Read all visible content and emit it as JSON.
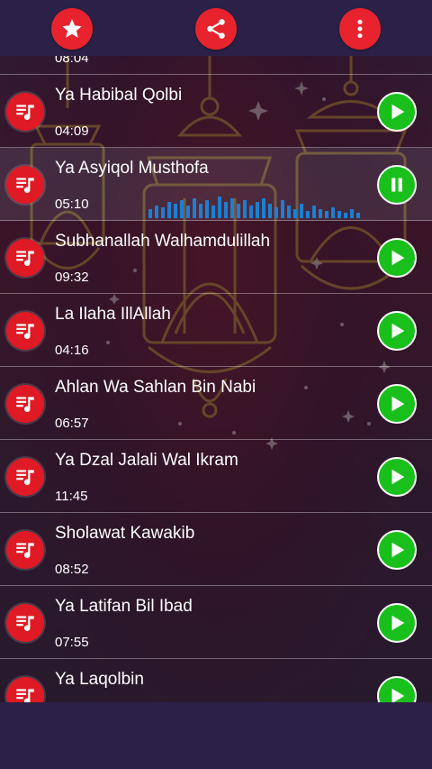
{
  "toolbar": {
    "favorite": "star-icon",
    "share": "share-icon",
    "more": "more-vertical-icon"
  },
  "colors": {
    "accent": "#e8232e",
    "play": "#19c01b",
    "bar_background": "#2b2146"
  },
  "playlist": {
    "partial_top_duration": "08:04",
    "now_playing_index": 1,
    "items": [
      {
        "title": "Ya Habibal Qolbi",
        "duration": "04:09",
        "state": "play"
      },
      {
        "title": "Ya Asyiqol Musthofa",
        "duration": "05:10",
        "state": "pause"
      },
      {
        "title": "Subhanallah Walhamdulillah",
        "duration": "09:32",
        "state": "play"
      },
      {
        "title": "La Ilaha IllAllah",
        "duration": "04:16",
        "state": "play"
      },
      {
        "title": "Ahlan Wa Sahlan Bin Nabi",
        "duration": "06:57",
        "state": "play"
      },
      {
        "title": "Ya Dzal Jalali Wal Ikram",
        "duration": "11:45",
        "state": "play"
      },
      {
        "title": "Sholawat Kawakib",
        "duration": "08:52",
        "state": "play"
      },
      {
        "title": "Ya Latifan Bil Ibad",
        "duration": "07:55",
        "state": "play"
      },
      {
        "title": "Ya Laqolbin",
        "duration": "",
        "state": "play"
      }
    ]
  }
}
